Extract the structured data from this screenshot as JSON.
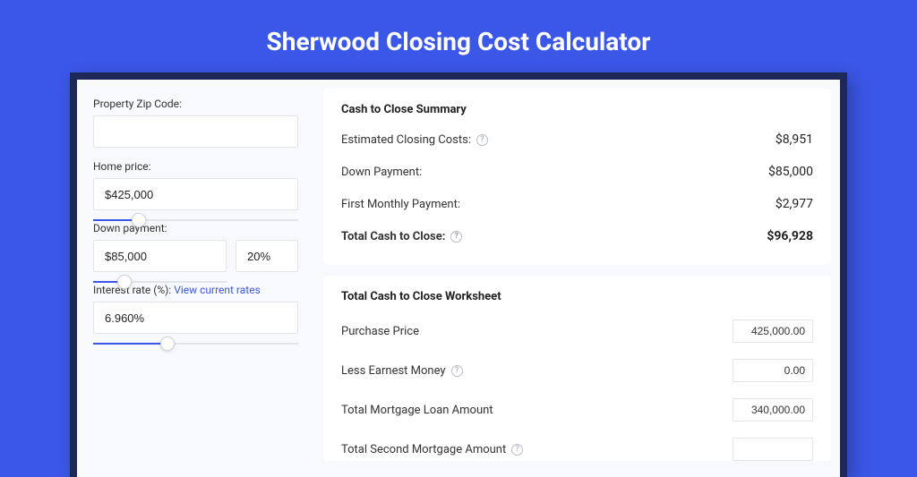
{
  "page_title": "Sherwood Closing Cost Calculator",
  "inputs": {
    "zip_label": "Property Zip Code:",
    "zip_value": "",
    "home_price_label": "Home price:",
    "home_price_value": "$425,000",
    "down_payment_label": "Down payment:",
    "down_payment_value": "$85,000",
    "down_payment_pct": "20%",
    "interest_label_prefix": "Interest rate (%): ",
    "interest_link": "View current rates",
    "interest_value": "6.960%"
  },
  "summary": {
    "title": "Cash to Close Summary",
    "rows": [
      {
        "label": "Estimated Closing Costs:",
        "help": true,
        "value": "$8,951",
        "bold": false
      },
      {
        "label": "Down Payment:",
        "help": false,
        "value": "$85,000",
        "bold": false
      },
      {
        "label": "First Monthly Payment:",
        "help": false,
        "value": "$2,977",
        "bold": false
      },
      {
        "label": "Total Cash to Close:",
        "help": true,
        "value": "$96,928",
        "bold": true
      }
    ]
  },
  "worksheet": {
    "title": "Total Cash to Close Worksheet",
    "rows": [
      {
        "label": "Purchase Price",
        "help": false,
        "value": "425,000.00"
      },
      {
        "label": "Less Earnest Money",
        "help": true,
        "value": "0.00"
      },
      {
        "label": "Total Mortgage Loan Amount",
        "help": false,
        "value": "340,000.00"
      },
      {
        "label": "Total Second Mortgage Amount",
        "help": true,
        "value": ""
      }
    ]
  }
}
